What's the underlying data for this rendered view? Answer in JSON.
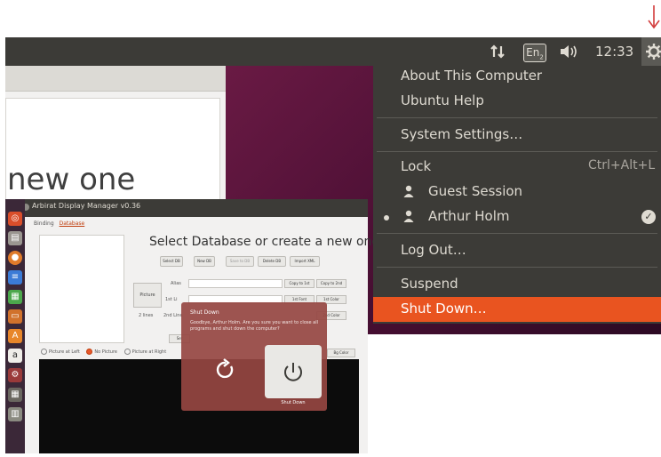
{
  "panel": {
    "keyboard_label": "En",
    "keyboard_sub": "2",
    "clock": "12:33"
  },
  "background_window": {
    "heading_fragment": "new one"
  },
  "app_window": {
    "title": "Arbirat Display Manager v0.36",
    "tabs": [
      "Binding",
      "Database"
    ],
    "heading": "Select Database or create a new one",
    "toolbar": [
      "Select DB",
      "New DB",
      "Save to DB",
      "Delete DB",
      "Import XML"
    ],
    "picture_label": "Picture",
    "fields": [
      {
        "label": "Alias",
        "button_left": "Copy to 1st",
        "button_right": "Copy to 2nd"
      },
      {
        "label": "1st Li",
        "button_left": "1st Font",
        "button_right": "1st Color"
      },
      {
        "label": "2nd Line",
        "button_left": "",
        "button_right": "2nd Color"
      }
    ],
    "lines_label": "2 lines",
    "radio_options": [
      "Picture at Left",
      "No Picture",
      "Picture at Right"
    ],
    "radio_selected": "No Picture",
    "bg_color_label": "Bg Color",
    "extra_button": "Set"
  },
  "launcher_icons": [
    "dash-icon",
    "files-icon",
    "firefox-icon",
    "writer-icon",
    "calc-icon",
    "impress-icon",
    "software-center-icon",
    "amazon-icon",
    "settings-icon",
    "workspaces-icon",
    "trash-icon"
  ],
  "shutdown_dialog": {
    "title": "Shut Down",
    "message": "Goodbye, Arthur Holm. Are you sure you want to close all programs and shut down the computer?",
    "shutdown_label": "Shut Down"
  },
  "session_menu": {
    "items": {
      "about": "About This Computer",
      "help": "Ubuntu Help",
      "settings": "System Settings…",
      "lock": "Lock",
      "lock_shortcut": "Ctrl+Alt+L",
      "guest": "Guest Session",
      "user": "Arthur Holm",
      "logout": "Log Out…",
      "suspend": "Suspend",
      "shutdown": "Shut Down…"
    },
    "highlighted": "Shut Down…"
  },
  "colors": {
    "panel": "#3c3b37",
    "menu_text": "#dfdbd2",
    "highlight": "#e95420",
    "arrow": "#d23c3c"
  }
}
